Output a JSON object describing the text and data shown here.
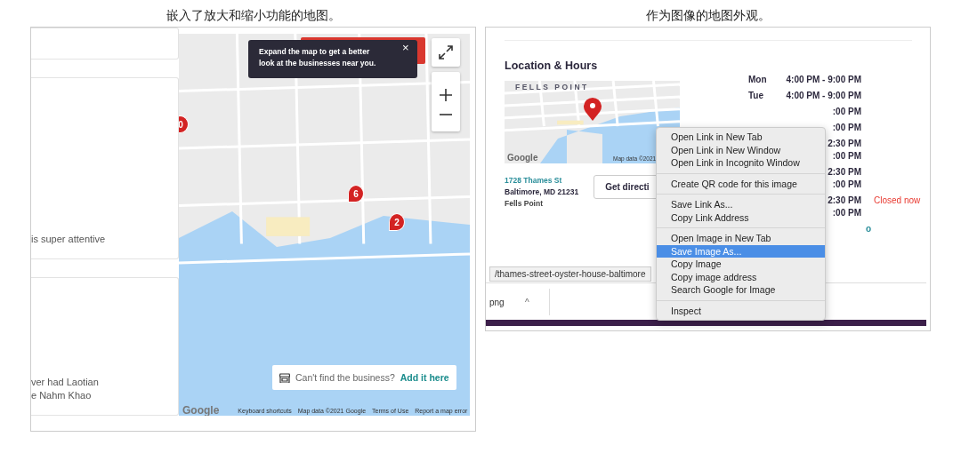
{
  "embedded_map_screenshot": {
    "caption": "嵌入了放大和缩小功能的地图。",
    "review_cards": [
      {
        "lines": [
          "is super attentive"
        ]
      },
      {
        "lines": [
          "ver had Laotian",
          "e Nahm Khao"
        ]
      }
    ],
    "map": {
      "pins": [
        "0",
        "6",
        "2"
      ],
      "tooltip": {
        "text": "Expand the map to get a better look at the businesses near you.",
        "close": "×"
      },
      "add_business": {
        "prompt": "Can't find the business?",
        "link": "Add it here"
      },
      "attribution": {
        "logo": "Google",
        "links": [
          "Keyboard shortcuts",
          "Map data ©2021 Google",
          "Terms of Use",
          "Report a map error"
        ]
      }
    }
  },
  "map_image_screenshot": {
    "caption": "作为图像的地图外观。",
    "heading": "Location & Hours",
    "map": {
      "label": "FELLS POINT",
      "logo": "Google",
      "attribution": "Map data ©2021"
    },
    "address": {
      "street": "1728 Thames St",
      "city": "Baltimore, MD 21231",
      "area": "Fells Point"
    },
    "directions_button": "Get directi",
    "hours": [
      {
        "day": "Mon",
        "times": [
          "4:00 PM - 9:00 PM"
        ]
      },
      {
        "day": "Tue",
        "times": [
          "4:00 PM - 9:00 PM"
        ]
      },
      {
        "times": [
          ":00 PM"
        ]
      },
      {
        "times": [
          ":00 PM"
        ]
      },
      {
        "times": [
          "2:30 PM",
          ":00 PM"
        ]
      },
      {
        "times": [
          "2:30 PM",
          ":00 PM"
        ]
      },
      {
        "times": [
          "2:30 PM",
          ":00 PM"
        ],
        "status": "Closed now"
      }
    ],
    "info_link": "o",
    "context_menu": [
      [
        {
          "label": "Open Link in New Tab",
          "selected": false
        },
        {
          "label": "Open Link in New Window",
          "selected": false
        },
        {
          "label": "Open Link in Incognito Window",
          "selected": false
        }
      ],
      [
        {
          "label": "Create QR code for this image",
          "selected": false
        }
      ],
      [
        {
          "label": "Save Link As...",
          "selected": false
        },
        {
          "label": "Copy Link Address",
          "selected": false
        }
      ],
      [
        {
          "label": "Open Image in New Tab",
          "selected": false
        },
        {
          "label": "Save Image As...",
          "selected": true
        },
        {
          "label": "Copy Image",
          "selected": false
        },
        {
          "label": "Copy image address",
          "selected": false
        },
        {
          "label": "Search Google for Image",
          "selected": false
        }
      ],
      [
        {
          "label": "Inspect",
          "selected": false
        }
      ]
    ],
    "status_url": "/thames-street-oyster-house-baltimore",
    "download": {
      "name": "png",
      "caret": "^"
    }
  }
}
